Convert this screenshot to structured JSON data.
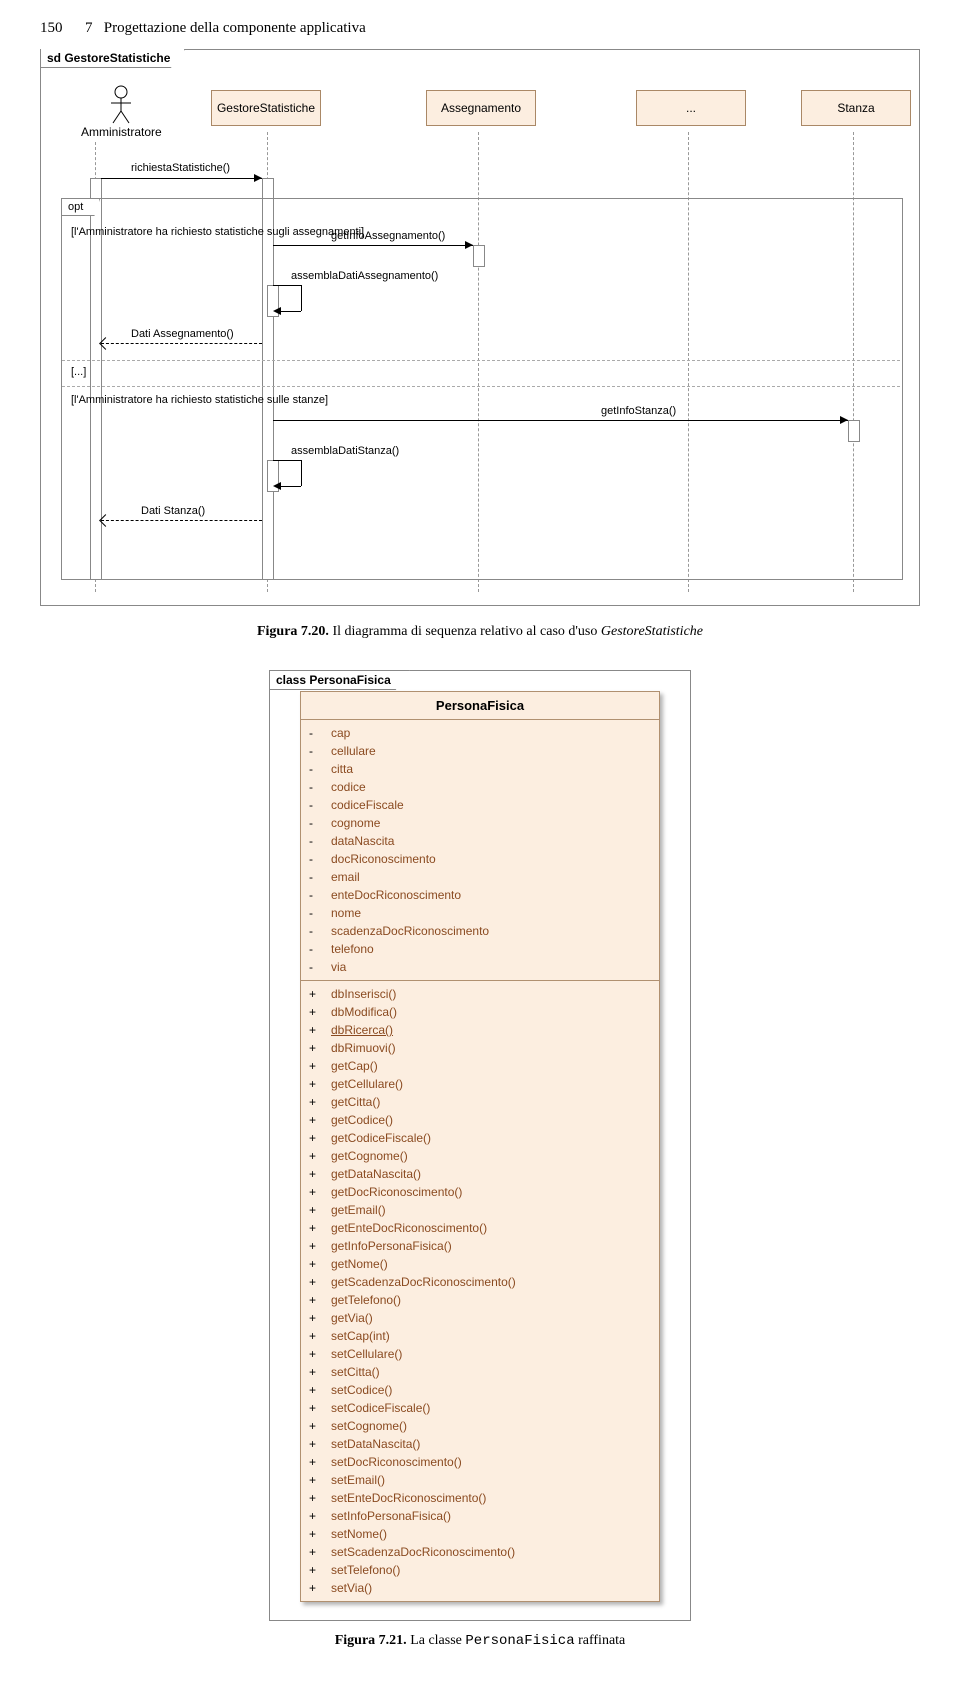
{
  "page": {
    "number": "150",
    "chapter": "7",
    "chapter_title": "Progettazione della componente applicativa"
  },
  "seq": {
    "frame_label": "sd GestoreStatistiche",
    "actor": "Amministratore",
    "lifelines": [
      "GestoreStatistiche",
      "Assegnamento",
      "...",
      "Stanza"
    ],
    "opt_label": "opt",
    "guard1": "[l'Amministratore ha richiesto statistiche sugli assegnamenti]",
    "guard_mid": "[...]",
    "guard2": "[l'Amministratore ha richiesto statistiche sulle stanze]",
    "messages": {
      "m1": "richiestaStatistiche()",
      "m2": "getInfoAssegnamento()",
      "m3": "assemblaDatiAssegnamento()",
      "m4": "Dati Assegnamento()",
      "m5": "getInfoStanza()",
      "m6": "assemblaDatiStanza()",
      "m7": "Dati Stanza()"
    }
  },
  "caption1": {
    "label": "Figura 7.20.",
    "text_a": "Il diagramma di sequenza relativo al caso d'uso ",
    "italic": "GestoreStatistiche"
  },
  "class": {
    "frame_label": "class PersonaFisica",
    "name": "PersonaFisica",
    "attrs": [
      "cap",
      "cellulare",
      "citta",
      "codice",
      "codiceFiscale",
      "cognome",
      "dataNascita",
      "docRiconoscimento",
      "email",
      "enteDocRiconoscimento",
      "nome",
      "scadenzaDocRiconoscimento",
      "telefono",
      "via"
    ],
    "ops": [
      {
        "n": "dbInserisci()"
      },
      {
        "n": "dbModifica()"
      },
      {
        "n": "dbRicerca()",
        "s": 1
      },
      {
        "n": "dbRimuovi()"
      },
      {
        "n": "getCap()"
      },
      {
        "n": "getCellulare()"
      },
      {
        "n": "getCitta()"
      },
      {
        "n": "getCodice()"
      },
      {
        "n": "getCodiceFiscale()"
      },
      {
        "n": "getCognome()"
      },
      {
        "n": "getDataNascita()"
      },
      {
        "n": "getDocRiconoscimento()"
      },
      {
        "n": "getEmail()"
      },
      {
        "n": "getEnteDocRiconoscimento()"
      },
      {
        "n": "getInfoPersonaFisica()"
      },
      {
        "n": "getNome()"
      },
      {
        "n": "getScadenzaDocRiconoscimento()"
      },
      {
        "n": "getTelefono()"
      },
      {
        "n": "getVia()"
      },
      {
        "n": "setCap(int)"
      },
      {
        "n": "setCellulare()"
      },
      {
        "n": "setCitta()"
      },
      {
        "n": "setCodice()"
      },
      {
        "n": "setCodiceFiscale()"
      },
      {
        "n": "setCognome()"
      },
      {
        "n": "setDataNascita()"
      },
      {
        "n": "setDocRiconoscimento()"
      },
      {
        "n": "setEmail()"
      },
      {
        "n": "setEnteDocRiconoscimento()"
      },
      {
        "n": "setInfoPersonaFisica()"
      },
      {
        "n": "setNome()"
      },
      {
        "n": "setScadenzaDocRiconoscimento()"
      },
      {
        "n": "setTelefono()"
      },
      {
        "n": "setVia()"
      }
    ]
  },
  "caption2": {
    "label": "Figura 7.21.",
    "text_a": "La classe ",
    "mono": "PersonaFisica",
    "text_b": " raffinata"
  }
}
